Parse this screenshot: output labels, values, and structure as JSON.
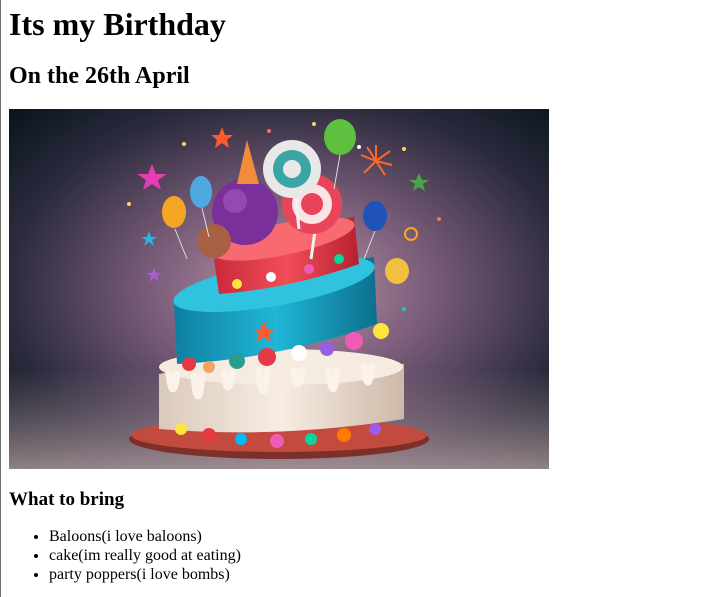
{
  "page": {
    "title": "Its my Birthday",
    "subtitle": "On the 26th April",
    "image": {
      "subject": "multi-tier birthday cake with lollipops, balloons and stars",
      "colors": {
        "background_dark": "#0d1a24",
        "background_glow": "#8a6a86",
        "tier_top": "#e83a4a",
        "tier_middle": "#19a9c8",
        "tier_bottom": "#f2e6d8",
        "plate": "#b3433a"
      }
    },
    "bring_heading": "What to bring",
    "bring_items": [
      "Baloons(i love baloons)",
      "cake(im really good at eating)",
      "party poppers(i love bombs)"
    ]
  }
}
